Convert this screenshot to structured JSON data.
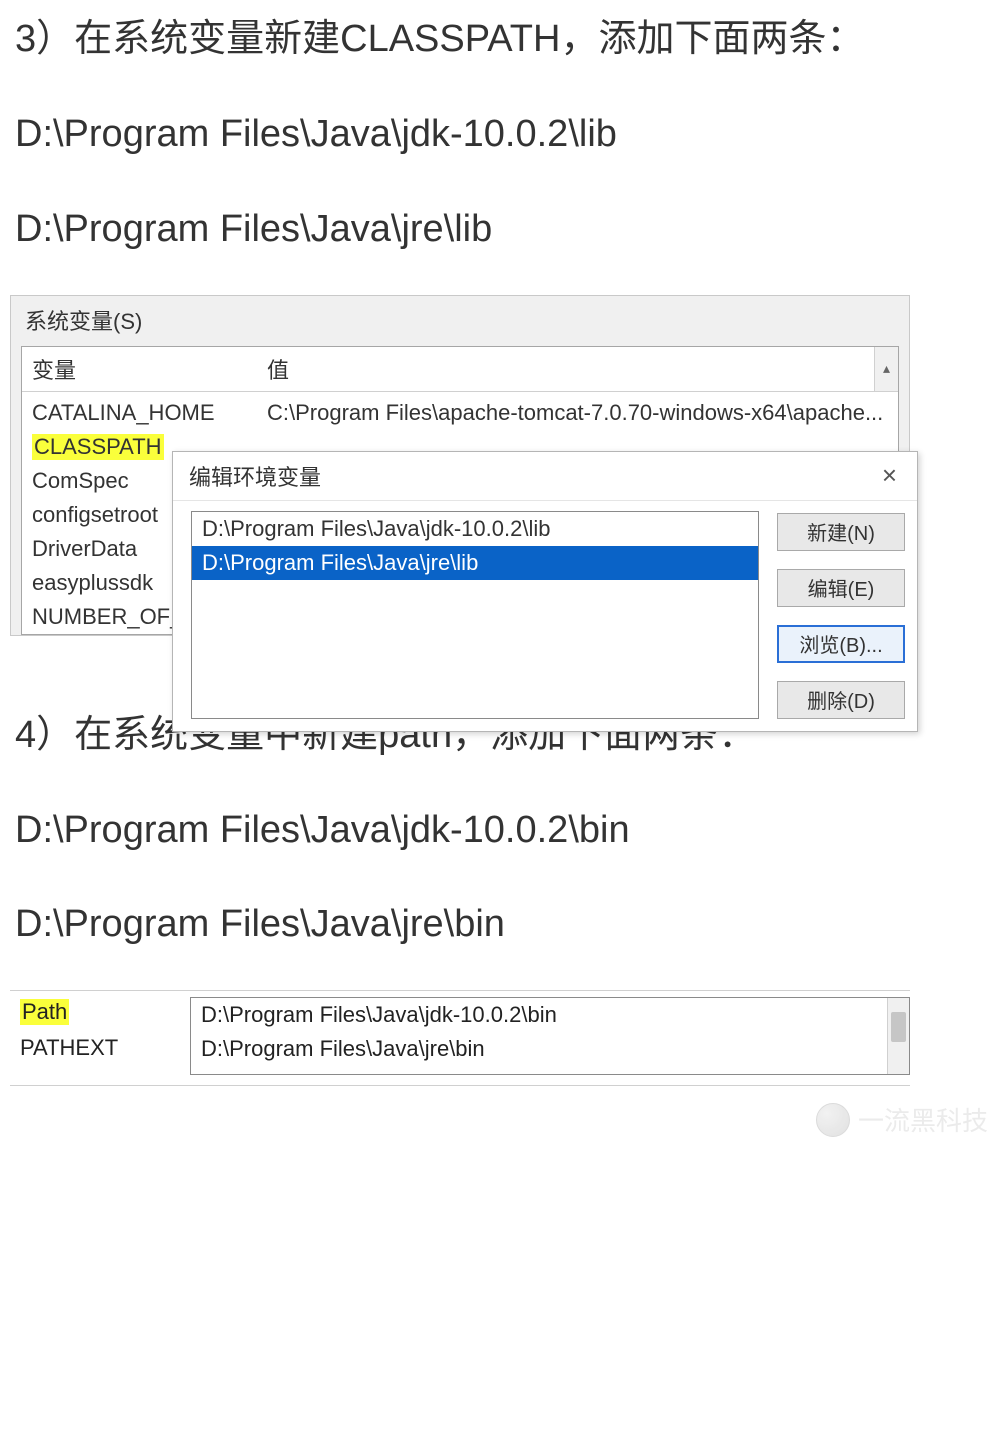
{
  "article": {
    "step3_heading": "3）在系统变量新建CLASSPATH，添加下面两条：",
    "step3_path1": "D:\\Program Files\\Java\\jdk-10.0.2\\lib",
    "step3_path2": "D:\\Program Files\\Java\\jre\\lib",
    "step4_heading": "4）在系统变量中新建path，添加下面两条：",
    "step4_path1": "D:\\Program Files\\Java\\jdk-10.0.2\\bin",
    "step4_path2": "D:\\Program Files\\Java\\jre\\bin"
  },
  "screenshot1": {
    "sysvar_label": "系统变量(S)",
    "header_col1": "变量",
    "header_col2": "值",
    "rows": [
      {
        "name": "CATALINA_HOME",
        "value": "C:\\Program Files\\apache-tomcat-7.0.70-windows-x64\\apache..."
      },
      {
        "name": "CLASSPATH",
        "value": ""
      },
      {
        "name": "ComSpec",
        "value": ""
      },
      {
        "name": "configsetroot",
        "value": ""
      },
      {
        "name": "DriverData",
        "value": ""
      },
      {
        "name": "easyplussdk",
        "value": ""
      },
      {
        "name": "NUMBER_OF_PR",
        "value": ""
      }
    ],
    "dialog": {
      "title": "编辑环境变量",
      "close": "×",
      "paths": [
        "D:\\Program Files\\Java\\jdk-10.0.2\\lib",
        "D:\\Program Files\\Java\\jre\\lib"
      ],
      "buttons": {
        "new": "新建(N)",
        "edit": "编辑(E)",
        "browse": "浏览(B)...",
        "delete": "删除(D)"
      }
    }
  },
  "screenshot2": {
    "left": {
      "path": "Path",
      "pathext": "PATHEXT"
    },
    "paths": [
      "D:\\Program Files\\Java\\jdk-10.0.2\\bin",
      "D:\\Program Files\\Java\\jre\\bin"
    ]
  },
  "watermark": {
    "text": "一流黑科技"
  }
}
